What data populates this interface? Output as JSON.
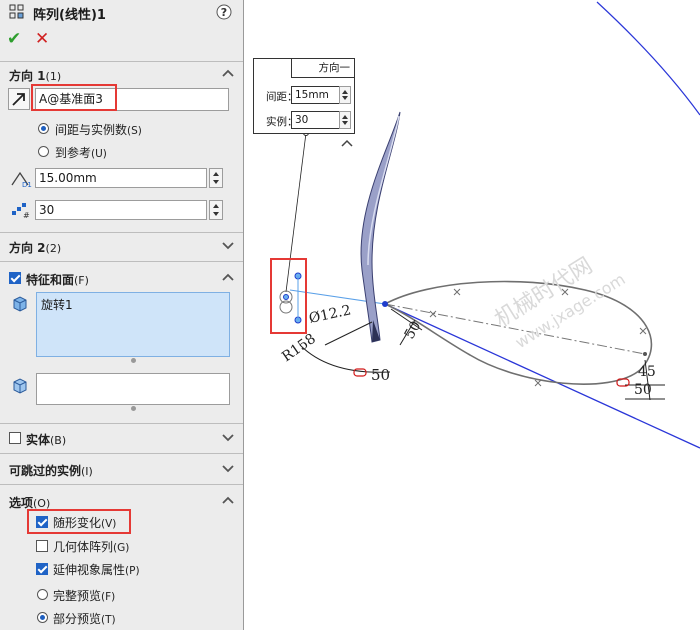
{
  "feature": {
    "title": "阵列(线性)1",
    "help_icon": "help-icon"
  },
  "actions": {
    "ok": "✔",
    "cancel": "✕"
  },
  "direction1": {
    "header": "方向 1",
    "header_key": "(1)",
    "reference": "A@基准面3",
    "spacing_mode_label": "间距与实例数",
    "spacing_mode_key": "(S)",
    "to_reference_label": "到参考",
    "to_reference_key": "(U)",
    "spacing_value": "15.00mm",
    "instances_value": "30"
  },
  "direction2": {
    "header": "方向 2",
    "header_key": "(2)"
  },
  "features_faces": {
    "header": "特征和面",
    "header_key": "(F)",
    "items": [
      "旋转1"
    ]
  },
  "bodies": {
    "header": "实体",
    "header_key": "(B)"
  },
  "skip_instances": {
    "header": "可跳过的实例",
    "header_key": "(I)"
  },
  "options": {
    "header": "选项",
    "header_key": "(O)",
    "vary_sketch": {
      "label": "随形变化",
      "key": "(V)",
      "checked": true
    },
    "geometry_pattern": {
      "label": "几何体阵列",
      "key": "(G)",
      "checked": false
    },
    "propagate_visual": {
      "label": "延伸视象属性",
      "key": "(P)",
      "checked": true
    },
    "full_preview": {
      "label": "完整预览",
      "key": "(F)",
      "selected": false
    },
    "partial_preview": {
      "label": "部分预览",
      "key": "(T)",
      "selected": true
    }
  },
  "viewport": {
    "callout": {
      "title": "方向一",
      "spacing_label": "间距：",
      "spacing_value": "15mm",
      "instances_label": "实例：",
      "instances_value": "30"
    },
    "dims": {
      "diameter": "Ø12.2",
      "radius": "R158",
      "dim50_a": "50",
      "dim50_b": "50",
      "dim50_c": "50",
      "dim45": "45"
    },
    "watermark": {
      "line1": "机械时代网",
      "line2": "www.jxage.com"
    }
  }
}
